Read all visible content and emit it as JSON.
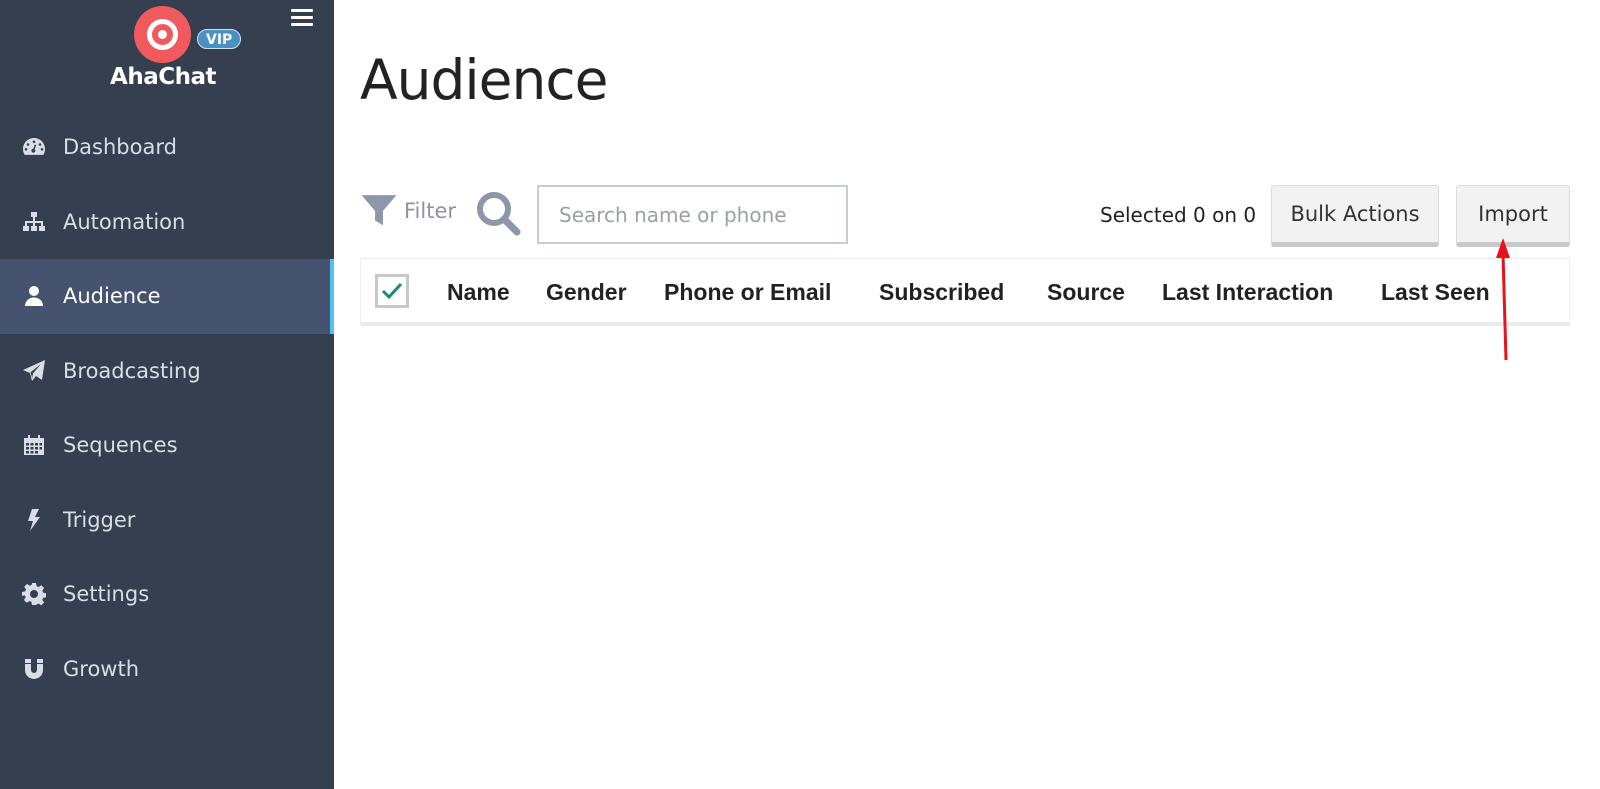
{
  "sidebar": {
    "brand": "AhaChat",
    "badge": "VIP",
    "items": [
      {
        "label": "Dashboard",
        "icon": "dashboard-icon"
      },
      {
        "label": "Automation",
        "icon": "sitemap-icon"
      },
      {
        "label": "Audience",
        "icon": "user-icon",
        "active": true
      },
      {
        "label": "Broadcasting",
        "icon": "paper-plane-icon"
      },
      {
        "label": "Sequences",
        "icon": "calendar-icon"
      },
      {
        "label": "Trigger",
        "icon": "bolt-icon"
      },
      {
        "label": "Settings",
        "icon": "gear-icon"
      },
      {
        "label": "Growth",
        "icon": "magnet-icon"
      }
    ]
  },
  "main": {
    "title": "Audience",
    "toolbar": {
      "filter_label": "Filter",
      "search_placeholder": "Search name or phone",
      "search_value": "",
      "selected_text": "Selected 0 on 0",
      "bulk_actions_label": "Bulk Actions",
      "import_label": "Import"
    },
    "table": {
      "columns": [
        "Name",
        "Gender",
        "Phone or Email",
        "Subscribed",
        "Source",
        "Last Interaction",
        "Last Seen"
      ],
      "rows": []
    }
  },
  "colors": {
    "sidebar_bg": "#353f4f",
    "sidebar_active_bg": "#46536f",
    "active_indicator": "#4fc3f7",
    "brand_red": "#f05a5e",
    "vip_blue": "#4a90c4",
    "check_teal": "#1a8a7a",
    "annotation_red": "#e8121c"
  }
}
